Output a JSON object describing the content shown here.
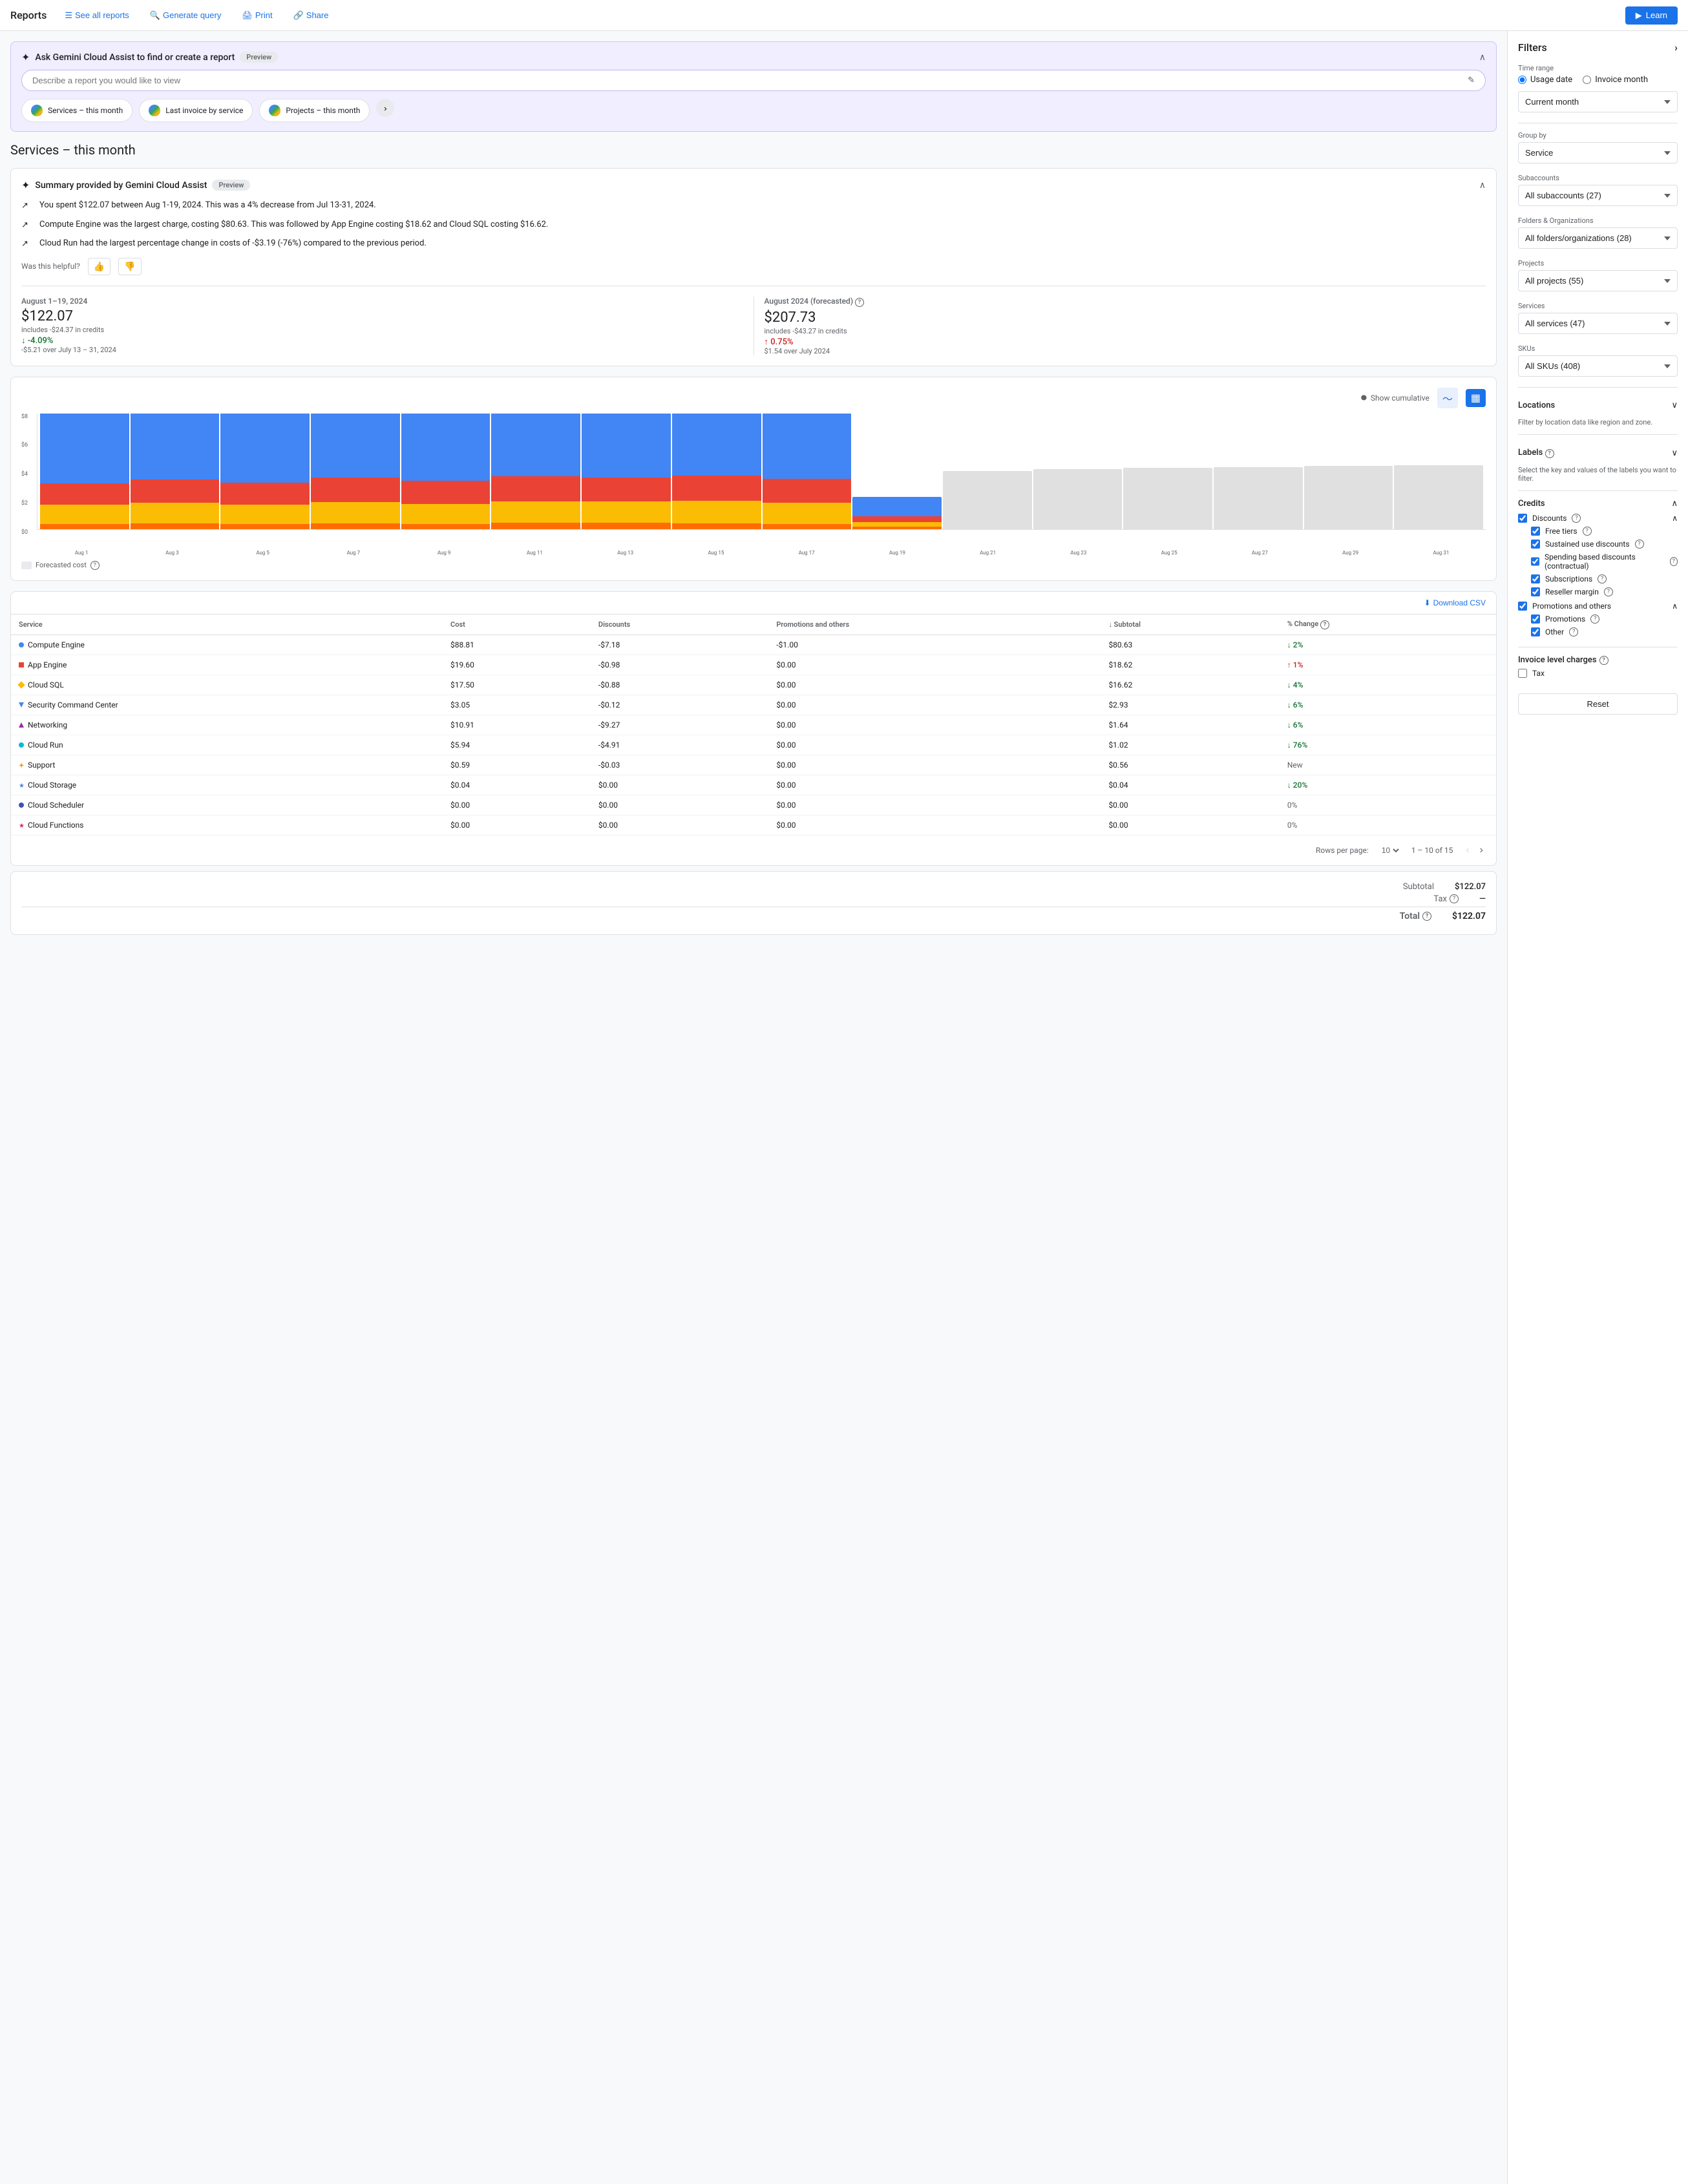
{
  "nav": {
    "title": "Reports",
    "see_all_reports": "See all reports",
    "generate_query": "Generate query",
    "print": "Print",
    "share": "Share",
    "learn": "Learn"
  },
  "ask_bar": {
    "title": "Ask Gemini Cloud Assist to find or create a report",
    "preview": "Preview",
    "placeholder": "Describe a report you would like to view",
    "chips": [
      "Services – this month",
      "Last invoice by service",
      "Projects – this month"
    ]
  },
  "page_title": "Services – this month",
  "summary": {
    "title": "Summary provided by Gemini Cloud Assist",
    "preview": "Preview",
    "bullets": [
      "You spent $122.07 between Aug 1-19, 2024. This was a 4% decrease from Jul 13-31, 2024.",
      "Compute Engine was the largest charge, costing $80.63. This was followed by App Engine costing $18.62 and Cloud SQL costing $16.62.",
      "Cloud Run had the largest percentage change in costs of -$3.19 (-76%) compared to the previous period."
    ],
    "helpful_label": "Was this helpful?"
  },
  "stats": {
    "current_period": "August 1–19, 2024",
    "current_amount": "$122.07",
    "current_credits": "includes -$24.37 in credits",
    "current_change": "↓ -4.09%",
    "current_change_sub": "-$5.21 over July 13 – 31, 2024",
    "current_change_type": "down",
    "forecast_period": "August 2024 (forecasted)",
    "forecast_amount": "$207.73",
    "forecast_credits": "includes -$43.27 in credits",
    "forecast_change": "↑ 0.75%",
    "forecast_change_sub": "$1.54 over July 2024",
    "forecast_change_type": "up"
  },
  "chart": {
    "y_label": "$8",
    "y_labels": [
      "$8",
      "$6",
      "$4",
      "$2",
      "$0"
    ],
    "bars": [
      {
        "label": "Aug 1",
        "compute": 75,
        "appengine": 22,
        "sql": 20,
        "other": 5,
        "forecast": false
      },
      {
        "label": "Aug 3",
        "compute": 80,
        "appengine": 24,
        "sql": 21,
        "other": 6,
        "forecast": false
      },
      {
        "label": "Aug 5",
        "compute": 82,
        "appengine": 23,
        "sql": 20,
        "other": 5,
        "forecast": false
      },
      {
        "label": "Aug 7",
        "compute": 83,
        "appengine": 25,
        "sql": 22,
        "other": 6,
        "forecast": false
      },
      {
        "label": "Aug 9",
        "compute": 84,
        "appengine": 24,
        "sql": 21,
        "other": 5,
        "forecast": false
      },
      {
        "label": "Aug 11",
        "compute": 85,
        "appengine": 26,
        "sql": 22,
        "other": 6,
        "forecast": false
      },
      {
        "label": "Aug 13",
        "compute": 86,
        "appengine": 25,
        "sql": 22,
        "other": 6,
        "forecast": false
      },
      {
        "label": "Aug 15",
        "compute": 87,
        "appengine": 26,
        "sql": 23,
        "other": 6,
        "forecast": false
      },
      {
        "label": "Aug 17",
        "compute": 86,
        "appengine": 25,
        "sql": 22,
        "other": 5,
        "forecast": false
      },
      {
        "label": "Aug 19",
        "compute": 20,
        "appengine": 6,
        "sql": 5,
        "other": 2,
        "forecast": false
      },
      {
        "label": "Aug 21",
        "compute": 60,
        "appengine": 0,
        "sql": 0,
        "other": 0,
        "forecast": true
      },
      {
        "label": "Aug 23",
        "compute": 62,
        "appengine": 0,
        "sql": 0,
        "other": 0,
        "forecast": true
      },
      {
        "label": "Aug 25",
        "compute": 63,
        "appengine": 0,
        "sql": 0,
        "other": 0,
        "forecast": true
      },
      {
        "label": "Aug 27",
        "compute": 64,
        "appengine": 0,
        "sql": 0,
        "other": 0,
        "forecast": true
      },
      {
        "label": "Aug 29",
        "compute": 65,
        "appengine": 0,
        "sql": 0,
        "other": 0,
        "forecast": true
      },
      {
        "label": "Aug 31",
        "compute": 66,
        "appengine": 0,
        "sql": 0,
        "other": 0,
        "forecast": true
      }
    ],
    "forecasted_label": "Forecasted cost",
    "show_cumulative": "Show cumulative"
  },
  "table": {
    "download_csv": "Download CSV",
    "headers": [
      "Service",
      "Cost",
      "Discounts",
      "Promotions and others",
      "↓ Subtotal",
      "% Change"
    ],
    "rows": [
      {
        "service": "Compute Engine",
        "color": "#4285f4",
        "shape": "circle",
        "cost": "$88.81",
        "discounts": "-$7.18",
        "promotions": "-$1.00",
        "subtotal": "$80.63",
        "change": "↓ 2%",
        "change_type": "down"
      },
      {
        "service": "App Engine",
        "color": "#ea4335",
        "shape": "square",
        "cost": "$19.60",
        "discounts": "-$0.98",
        "promotions": "$0.00",
        "subtotal": "$18.62",
        "change": "↑ 1%",
        "change_type": "up"
      },
      {
        "service": "Cloud SQL",
        "color": "#fbbc04",
        "shape": "diamond",
        "cost": "$17.50",
        "discounts": "-$0.88",
        "promotions": "$0.00",
        "subtotal": "$16.62",
        "change": "↓ 4%",
        "change_type": "down"
      },
      {
        "service": "Security Command Center",
        "color": "#4285f4",
        "shape": "down-triangle",
        "cost": "$3.05",
        "discounts": "-$0.12",
        "promotions": "$0.00",
        "subtotal": "$2.93",
        "change": "↓ 6%",
        "change_type": "down"
      },
      {
        "service": "Networking",
        "color": "#9c27b0",
        "shape": "up-triangle",
        "cost": "$10.91",
        "discounts": "-$9.27",
        "promotions": "$0.00",
        "subtotal": "$1.64",
        "change": "↓ 6%",
        "change_type": "down"
      },
      {
        "service": "Cloud Run",
        "color": "#00bcd4",
        "shape": "circle",
        "cost": "$5.94",
        "discounts": "-$4.91",
        "promotions": "$0.00",
        "subtotal": "$1.02",
        "change": "↓ 76%",
        "change_type": "down"
      },
      {
        "service": "Support",
        "color": "#ff9800",
        "shape": "plus",
        "cost": "$0.59",
        "discounts": "-$0.03",
        "promotions": "$0.00",
        "subtotal": "$0.56",
        "change": "New",
        "change_type": "new"
      },
      {
        "service": "Cloud Storage",
        "color": "#4285f4",
        "shape": "star",
        "cost": "$0.04",
        "discounts": "$0.00",
        "promotions": "$0.00",
        "subtotal": "$0.04",
        "change": "↓ 20%",
        "change_type": "down"
      },
      {
        "service": "Cloud Scheduler",
        "color": "#3f51b5",
        "shape": "circle",
        "cost": "$0.00",
        "discounts": "$0.00",
        "promotions": "$0.00",
        "subtotal": "$0.00",
        "change": "0%",
        "change_type": "neutral"
      },
      {
        "service": "Cloud Functions",
        "color": "#e91e63",
        "shape": "star",
        "cost": "$0.00",
        "discounts": "$0.00",
        "promotions": "$0.00",
        "subtotal": "$0.00",
        "change": "0%",
        "change_type": "neutral"
      }
    ],
    "rows_per_page_label": "Rows per page:",
    "rows_per_page": "10",
    "pagination": "1 – 10 of 15"
  },
  "totals": {
    "subtotal_label": "Subtotal",
    "subtotal_value": "$122.07",
    "tax_label": "Tax",
    "tax_value": "—",
    "total_label": "Total",
    "total_value": "$122.07"
  },
  "filters": {
    "title": "Filters",
    "time_range_label": "Time range",
    "usage_date": "Usage date",
    "invoice_month": "Invoice month",
    "current_month": "Current month",
    "group_by_label": "Group by",
    "group_by_value": "Service",
    "subaccounts_label": "Subaccounts",
    "subaccounts_value": "All subaccounts (27)",
    "folders_label": "Folders & Organizations",
    "folders_value": "All folders/organizations (28)",
    "projects_label": "Projects",
    "projects_value": "All projects (55)",
    "services_label": "Services",
    "services_value": "All services (47)",
    "skus_label": "SKUs",
    "skus_value": "All SKUs (408)",
    "locations_label": "Locations",
    "locations_desc": "Filter by location data like region and zone.",
    "labels_label": "Labels",
    "labels_desc": "Select the key and values of the labels you want to filter.",
    "credits_label": "Credits",
    "discounts_label": "Discounts",
    "free_tiers_label": "Free tiers",
    "sustained_label": "Sustained use discounts",
    "spending_label": "Spending based discounts (contractual)",
    "subscriptions_label": "Subscriptions",
    "reseller_label": "Reseller margin",
    "promotions_others_label": "Promotions and others",
    "promotions_label": "Promotions",
    "other_label": "Other",
    "invoice_charges_label": "Invoice level charges",
    "tax_label": "Tax",
    "reset_label": "Reset"
  }
}
